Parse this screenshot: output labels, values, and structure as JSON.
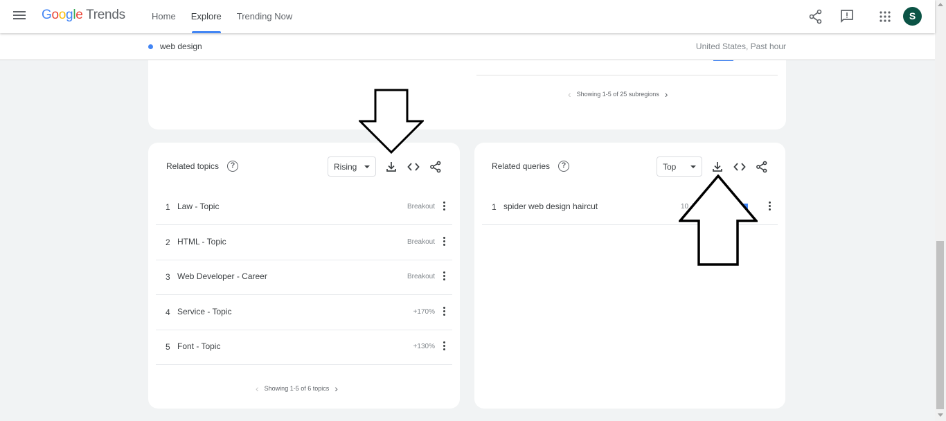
{
  "header": {
    "logo_parts": [
      "G",
      "o",
      "o",
      "g",
      "l",
      "e"
    ],
    "logo_suffix": " Trends",
    "nav": [
      {
        "label": "Home"
      },
      {
        "label": "Explore"
      },
      {
        "label": "Trending Now"
      }
    ],
    "avatar_letter": "S"
  },
  "subbar": {
    "term": "web design",
    "context": "United States, Past hour"
  },
  "region_card": {
    "pager_text": "Showing 1-5 of 25 subregions"
  },
  "related_topics": {
    "title": "Related topics",
    "help": "?",
    "filter": "Rising",
    "rows": [
      {
        "rank": "1",
        "label": "Law - Topic",
        "value": "Breakout"
      },
      {
        "rank": "2",
        "label": "HTML - Topic",
        "value": "Breakout"
      },
      {
        "rank": "3",
        "label": "Web Developer - Career",
        "value": "Breakout"
      },
      {
        "rank": "4",
        "label": "Service - Topic",
        "value": "+170%"
      },
      {
        "rank": "5",
        "label": "Font - Topic",
        "value": "+130%"
      }
    ],
    "pager_text": "Showing 1-5 of 6 topics"
  },
  "related_queries": {
    "title": "Related queries",
    "help": "?",
    "filter": "Top",
    "rows": [
      {
        "rank": "1",
        "label": "spider web design haircut",
        "value": "10",
        "bar_fraction": 1.0
      }
    ]
  },
  "icons": {
    "menu": "menu-icon",
    "share": "share-icon",
    "feedback": "feedback-icon",
    "apps": "apps-icon",
    "download": "download-icon",
    "embed": "code-icon",
    "more": "more-vert-icon"
  },
  "colors": {
    "accent": "#4285f4",
    "avatar": "#0b5345",
    "background": "#f1f3f4"
  }
}
